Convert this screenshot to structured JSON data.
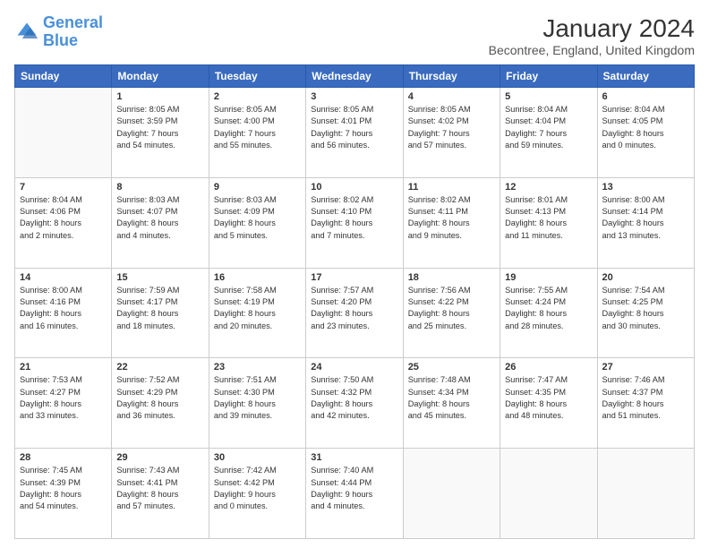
{
  "logo": {
    "line1": "General",
    "line2": "Blue"
  },
  "title": "January 2024",
  "subtitle": "Becontree, England, United Kingdom",
  "days_header": [
    "Sunday",
    "Monday",
    "Tuesday",
    "Wednesday",
    "Thursday",
    "Friday",
    "Saturday"
  ],
  "weeks": [
    [
      {
        "num": "",
        "data": ""
      },
      {
        "num": "1",
        "data": "Sunrise: 8:05 AM\nSunset: 3:59 PM\nDaylight: 7 hours\nand 54 minutes."
      },
      {
        "num": "2",
        "data": "Sunrise: 8:05 AM\nSunset: 4:00 PM\nDaylight: 7 hours\nand 55 minutes."
      },
      {
        "num": "3",
        "data": "Sunrise: 8:05 AM\nSunset: 4:01 PM\nDaylight: 7 hours\nand 56 minutes."
      },
      {
        "num": "4",
        "data": "Sunrise: 8:05 AM\nSunset: 4:02 PM\nDaylight: 7 hours\nand 57 minutes."
      },
      {
        "num": "5",
        "data": "Sunrise: 8:04 AM\nSunset: 4:04 PM\nDaylight: 7 hours\nand 59 minutes."
      },
      {
        "num": "6",
        "data": "Sunrise: 8:04 AM\nSunset: 4:05 PM\nDaylight: 8 hours\nand 0 minutes."
      }
    ],
    [
      {
        "num": "7",
        "data": "Sunrise: 8:04 AM\nSunset: 4:06 PM\nDaylight: 8 hours\nand 2 minutes."
      },
      {
        "num": "8",
        "data": "Sunrise: 8:03 AM\nSunset: 4:07 PM\nDaylight: 8 hours\nand 4 minutes."
      },
      {
        "num": "9",
        "data": "Sunrise: 8:03 AM\nSunset: 4:09 PM\nDaylight: 8 hours\nand 5 minutes."
      },
      {
        "num": "10",
        "data": "Sunrise: 8:02 AM\nSunset: 4:10 PM\nDaylight: 8 hours\nand 7 minutes."
      },
      {
        "num": "11",
        "data": "Sunrise: 8:02 AM\nSunset: 4:11 PM\nDaylight: 8 hours\nand 9 minutes."
      },
      {
        "num": "12",
        "data": "Sunrise: 8:01 AM\nSunset: 4:13 PM\nDaylight: 8 hours\nand 11 minutes."
      },
      {
        "num": "13",
        "data": "Sunrise: 8:00 AM\nSunset: 4:14 PM\nDaylight: 8 hours\nand 13 minutes."
      }
    ],
    [
      {
        "num": "14",
        "data": "Sunrise: 8:00 AM\nSunset: 4:16 PM\nDaylight: 8 hours\nand 16 minutes."
      },
      {
        "num": "15",
        "data": "Sunrise: 7:59 AM\nSunset: 4:17 PM\nDaylight: 8 hours\nand 18 minutes."
      },
      {
        "num": "16",
        "data": "Sunrise: 7:58 AM\nSunset: 4:19 PM\nDaylight: 8 hours\nand 20 minutes."
      },
      {
        "num": "17",
        "data": "Sunrise: 7:57 AM\nSunset: 4:20 PM\nDaylight: 8 hours\nand 23 minutes."
      },
      {
        "num": "18",
        "data": "Sunrise: 7:56 AM\nSunset: 4:22 PM\nDaylight: 8 hours\nand 25 minutes."
      },
      {
        "num": "19",
        "data": "Sunrise: 7:55 AM\nSunset: 4:24 PM\nDaylight: 8 hours\nand 28 minutes."
      },
      {
        "num": "20",
        "data": "Sunrise: 7:54 AM\nSunset: 4:25 PM\nDaylight: 8 hours\nand 30 minutes."
      }
    ],
    [
      {
        "num": "21",
        "data": "Sunrise: 7:53 AM\nSunset: 4:27 PM\nDaylight: 8 hours\nand 33 minutes."
      },
      {
        "num": "22",
        "data": "Sunrise: 7:52 AM\nSunset: 4:29 PM\nDaylight: 8 hours\nand 36 minutes."
      },
      {
        "num": "23",
        "data": "Sunrise: 7:51 AM\nSunset: 4:30 PM\nDaylight: 8 hours\nand 39 minutes."
      },
      {
        "num": "24",
        "data": "Sunrise: 7:50 AM\nSunset: 4:32 PM\nDaylight: 8 hours\nand 42 minutes."
      },
      {
        "num": "25",
        "data": "Sunrise: 7:48 AM\nSunset: 4:34 PM\nDaylight: 8 hours\nand 45 minutes."
      },
      {
        "num": "26",
        "data": "Sunrise: 7:47 AM\nSunset: 4:35 PM\nDaylight: 8 hours\nand 48 minutes."
      },
      {
        "num": "27",
        "data": "Sunrise: 7:46 AM\nSunset: 4:37 PM\nDaylight: 8 hours\nand 51 minutes."
      }
    ],
    [
      {
        "num": "28",
        "data": "Sunrise: 7:45 AM\nSunset: 4:39 PM\nDaylight: 8 hours\nand 54 minutes."
      },
      {
        "num": "29",
        "data": "Sunrise: 7:43 AM\nSunset: 4:41 PM\nDaylight: 8 hours\nand 57 minutes."
      },
      {
        "num": "30",
        "data": "Sunrise: 7:42 AM\nSunset: 4:42 PM\nDaylight: 9 hours\nand 0 minutes."
      },
      {
        "num": "31",
        "data": "Sunrise: 7:40 AM\nSunset: 4:44 PM\nDaylight: 9 hours\nand 4 minutes."
      },
      {
        "num": "",
        "data": ""
      },
      {
        "num": "",
        "data": ""
      },
      {
        "num": "",
        "data": ""
      }
    ]
  ]
}
